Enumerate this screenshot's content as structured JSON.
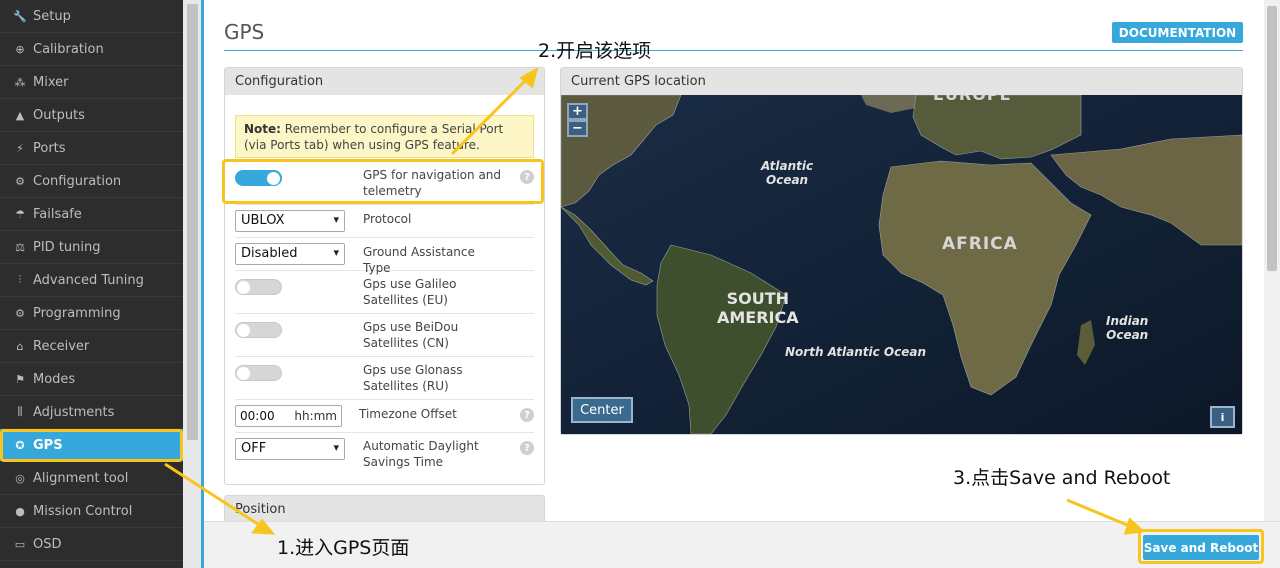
{
  "sidebar": {
    "items": [
      {
        "label": "Setup",
        "icon": "wrench-icon",
        "active": false
      },
      {
        "label": "Calibration",
        "icon": "crosshair-icon",
        "active": false
      },
      {
        "label": "Mixer",
        "icon": "mixer-icon",
        "active": false
      },
      {
        "label": "Outputs",
        "icon": "motor-icon",
        "active": false
      },
      {
        "label": "Ports",
        "icon": "plug-icon",
        "active": false
      },
      {
        "label": "Configuration",
        "icon": "gear-icon",
        "active": false
      },
      {
        "label": "Failsafe",
        "icon": "parachute-icon",
        "active": false
      },
      {
        "label": "PID tuning",
        "icon": "pid-icon",
        "active": false
      },
      {
        "label": "Advanced Tuning",
        "icon": "advanced-tuning-icon",
        "active": false
      },
      {
        "label": "Programming",
        "icon": "gear-icon",
        "active": false
      },
      {
        "label": "Receiver",
        "icon": "receiver-icon",
        "active": false
      },
      {
        "label": "Modes",
        "icon": "modes-icon",
        "active": false
      },
      {
        "label": "Adjustments",
        "icon": "sliders-icon",
        "active": false
      },
      {
        "label": "GPS",
        "icon": "satellite-icon",
        "active": true
      },
      {
        "label": "Alignment tool",
        "icon": "compass-icon",
        "active": false
      },
      {
        "label": "Mission Control",
        "icon": "map-pin-icon",
        "active": false
      },
      {
        "label": "OSD",
        "icon": "osd-icon",
        "active": false
      }
    ]
  },
  "header": {
    "title": "GPS",
    "documentation_label": "DOCUMENTATION"
  },
  "config": {
    "title": "Configuration",
    "note_bold": "Note:",
    "note_text": " Remember to configure a Serial Port (via Ports tab) when using GPS feature.",
    "gps_nav_label": "GPS for navigation and telemetry",
    "gps_nav_enabled": true,
    "protocol_value": "UBLOX",
    "protocol_label": "Protocol",
    "ground_assist_value": "Disabled",
    "ground_assist_label": "Ground Assistance Type",
    "galileo_label": "Gps use Galileo Satellites (EU)",
    "galileo_enabled": false,
    "beidou_label": "Gps use BeiDou Satellites (CN)",
    "beidou_enabled": false,
    "glonass_label": "Gps use Glonass Satellites (RU)",
    "glonass_enabled": false,
    "timezone_value": "00:00",
    "timezone_unit": "hh:mm",
    "timezone_label": "Timezone Offset",
    "dst_value": "OFF",
    "dst_label": "Automatic Daylight Savings Time",
    "help_glyph": "?"
  },
  "position": {
    "title": "Position"
  },
  "map": {
    "title": "Current GPS location",
    "zoom_in": "+",
    "zoom_out": "−",
    "center_label": "Center",
    "info_label": "i",
    "labels": {
      "europe": "EUROPE",
      "atlantic_1": "Atlantic",
      "atlantic_2": "Ocean",
      "africa": "AFRICA",
      "south_america_1": "SOUTH",
      "south_america_2": "AMERICA",
      "north_atlantic": "North Atlantic Ocean",
      "indian_1": "Indian",
      "indian_2": "Ocean"
    }
  },
  "footer": {
    "save_label": "Save and Reboot"
  },
  "annotations": {
    "step1": "1.进入GPS页面",
    "step2": "2.开启该选项",
    "step3": "3.点击Save and Reboot"
  },
  "colors": {
    "accent": "#37a8db",
    "highlight": "#f7c51e",
    "sidebar_bg": "#2d2d2d"
  }
}
